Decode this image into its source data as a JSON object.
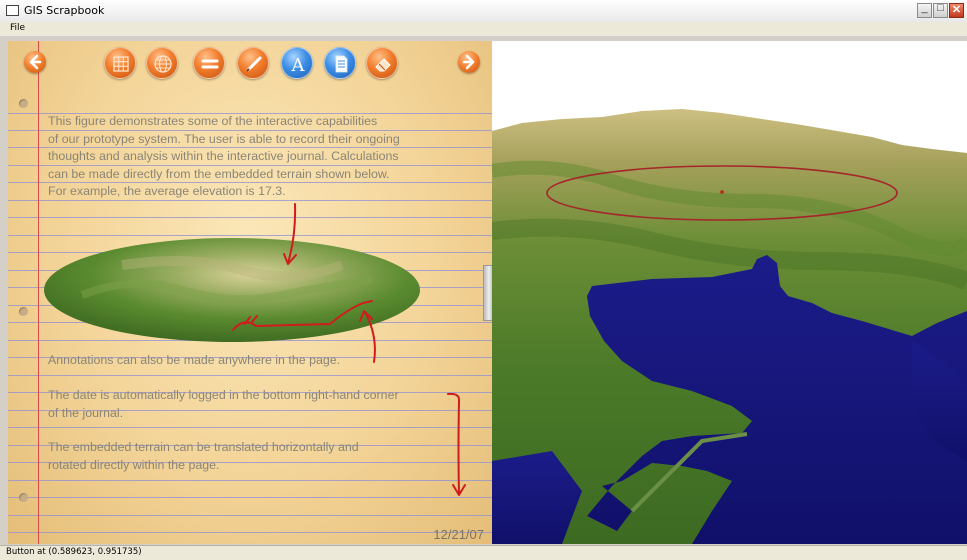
{
  "window": {
    "title": "GIS Scrapbook",
    "controls": [
      "minimize-icon",
      "maximize-icon",
      "close-icon"
    ]
  },
  "menu": {
    "items": [
      "File"
    ]
  },
  "toolbar": {
    "nav_left_icon": "arrow-left-icon",
    "nav_right_icon": "arrow-right-icon",
    "tools": [
      {
        "icon": "grid-icon",
        "color": "orange"
      },
      {
        "icon": "globe-icon",
        "color": "orange"
      },
      {
        "icon": "equals-icon",
        "color": "orange"
      },
      {
        "icon": "pen-icon",
        "color": "orange"
      },
      {
        "icon": "text-icon",
        "label": "A",
        "color": "blue"
      },
      {
        "icon": "page-icon",
        "color": "blue"
      },
      {
        "icon": "eraser-icon",
        "color": "orange"
      }
    ]
  },
  "journal": {
    "paragraph1": [
      "This figure demonstrates some of the interactive capabilities",
      "of our prototype system.  The user is able to record their ongoing",
      "thoughts and analysis within the interactive journal.  Calculations",
      "can be made directly from the embedded terrain shown below.",
      "For example, the average elevation is  17.3."
    ],
    "annotation_text": "Annotations can also be made anywhere in the page.",
    "date_para": [
      "The date is automatically logged in the bottom right-hand corner",
      "of the journal."
    ],
    "terrain_para": [
      "The embedded terrain can be translated horizontally and",
      "rotated directly within the page."
    ],
    "date": "12/21/07"
  },
  "status": {
    "text": "Button at (0.589623, 0.951735)"
  },
  "colors": {
    "paper": "#f3d498",
    "rule_line": "#8f8fd6",
    "margin_line": "#d64a4a",
    "annotation": "#d01c1c",
    "water": "#15157a",
    "terrain_green": "#4e7a2a"
  }
}
